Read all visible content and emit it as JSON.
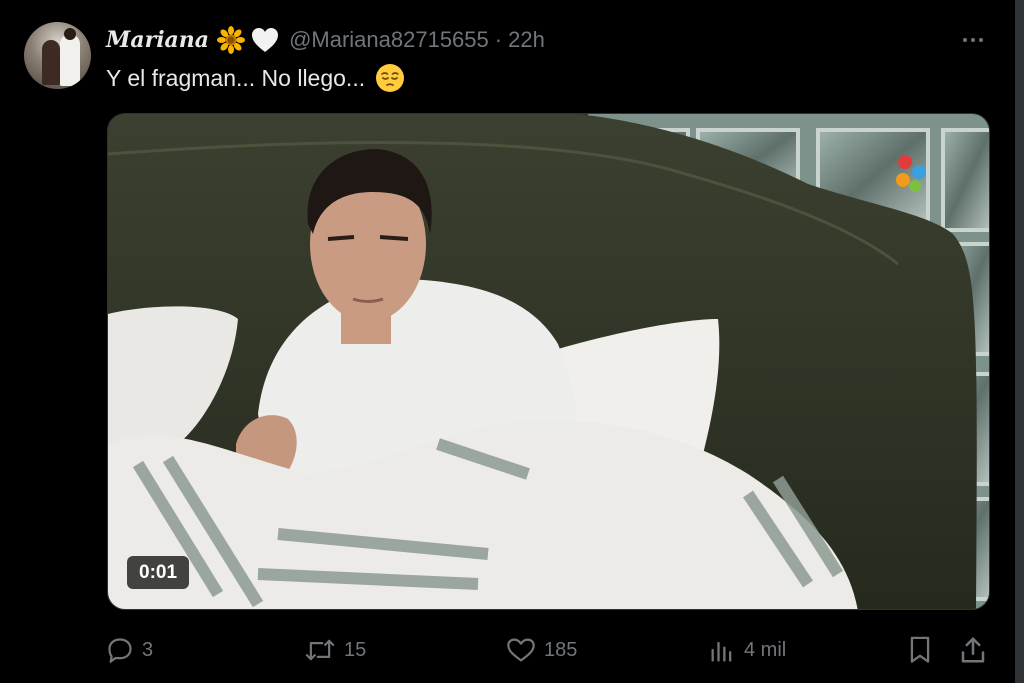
{
  "tweet": {
    "display_name": "Mariana",
    "name_emojis": [
      "sunflower-emoji",
      "white-heart-emoji"
    ],
    "handle": "@Mariana82715655",
    "separator": "·",
    "time_ago": "22h",
    "text": "Y el fragman... No llego...",
    "text_emoji": "pensive-face-emoji",
    "more_icon": "more-horizontal-icon"
  },
  "media": {
    "type": "video",
    "elapsed": "0:01"
  },
  "actions": {
    "replies": "3",
    "reposts": "15",
    "likes": "185",
    "views": "4 mil"
  },
  "icons": {
    "reply": "reply-icon",
    "repost": "repost-icon",
    "like": "heart-icon",
    "views": "analytics-icon",
    "bookmark": "bookmark-icon",
    "share": "share-icon"
  },
  "colors": {
    "background": "#000000",
    "text_primary": "#e7e9ea",
    "text_secondary": "#71767b",
    "border": "#2f3336"
  }
}
